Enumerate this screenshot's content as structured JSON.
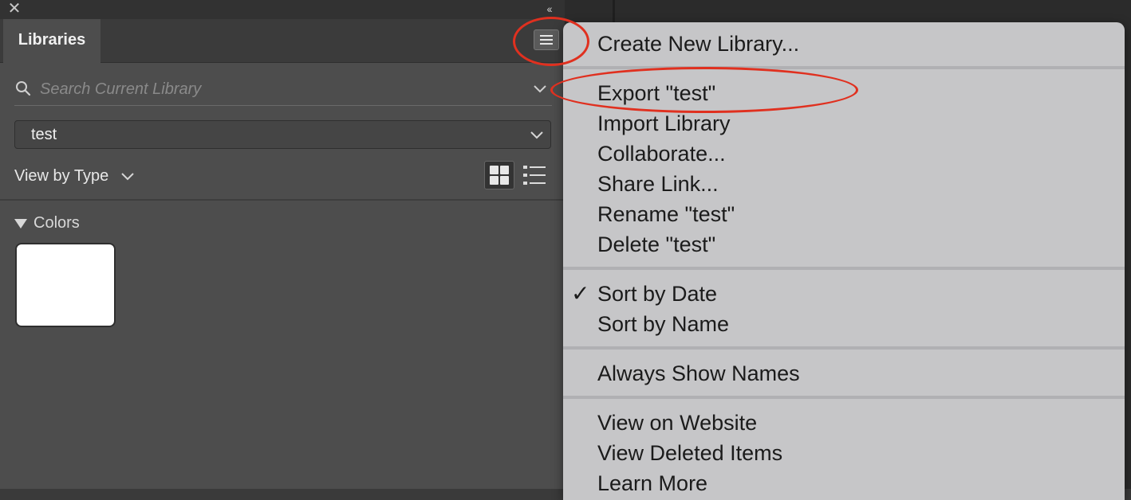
{
  "panel": {
    "tab_label": "Libraries",
    "search_placeholder": "Search Current Library",
    "library_select_value": "test",
    "view_by_label": "View by Type",
    "section_label": "Colors",
    "swatch_color": "#ffffff"
  },
  "icons": {
    "close": "close-icon",
    "collapse": "double-chevron-left-icon",
    "menu": "hamburger-menu-icon",
    "search": "search-icon",
    "grid": "grid-view-icon",
    "list": "list-view-icon"
  },
  "menu": {
    "items": [
      {
        "label": "Create New Library...",
        "checked": false
      },
      {
        "label": "Export \"test\"",
        "checked": false
      },
      {
        "label": "Import Library",
        "checked": false
      },
      {
        "label": "Collaborate...",
        "checked": false
      },
      {
        "label": "Share Link...",
        "checked": false
      },
      {
        "label": "Rename \"test\"",
        "checked": false
      },
      {
        "label": "Delete \"test\"",
        "checked": false
      },
      {
        "label": "Sort by Date",
        "checked": true
      },
      {
        "label": "Sort by Name",
        "checked": false
      },
      {
        "label": "Always Show Names",
        "checked": false
      },
      {
        "label": "View on Website",
        "checked": false
      },
      {
        "label": "View Deleted Items",
        "checked": false
      },
      {
        "label": "Learn More",
        "checked": false
      }
    ],
    "check_glyph": "✓"
  },
  "colors": {
    "annotation": "#e0301f",
    "menu_bg": "#c6c6c8",
    "panel_bg": "#4d4d4d"
  }
}
